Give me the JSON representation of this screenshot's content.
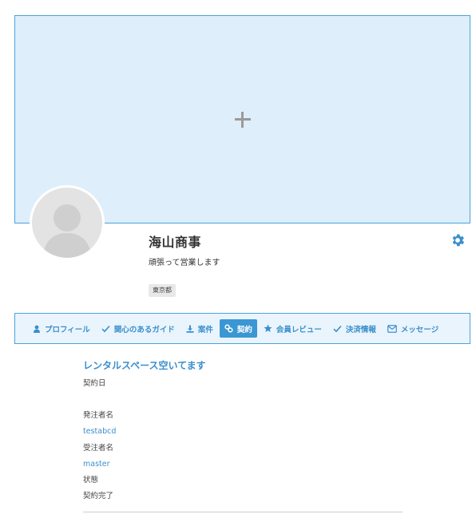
{
  "cover": {
    "add_icon": "plus-icon"
  },
  "profile": {
    "name": "海山商事",
    "tagline": "頑張って営業します",
    "location": "東京都",
    "settings_icon": "gear-icon"
  },
  "tabs": [
    {
      "label": "プロフィール",
      "icon": "user-icon",
      "active": false
    },
    {
      "label": "関心のあるガイド",
      "icon": "check-icon",
      "active": false
    },
    {
      "label": "案件",
      "icon": "download-icon",
      "active": false
    },
    {
      "label": "契約",
      "icon": "link-icon",
      "active": true
    },
    {
      "label": "会員レビュー",
      "icon": "star-icon",
      "active": false
    },
    {
      "label": "決済情報",
      "icon": "check-icon",
      "active": false
    },
    {
      "label": "メッセージ",
      "icon": "envelope-icon",
      "active": false
    }
  ],
  "contract": {
    "title": "レンタルスペース空いてます",
    "date_label": "契約日",
    "date_value": "",
    "orderer_label": "発注者名",
    "orderer_value": "testabcd",
    "contractor_label": "受注者名",
    "contractor_value": "master",
    "status_label": "状態",
    "status_value": "契約完了"
  },
  "colors": {
    "accent": "#3a8fcc",
    "cover_bg": "#deeefb",
    "border": "#4aa3d9",
    "active_tab": "#3a97d4"
  }
}
